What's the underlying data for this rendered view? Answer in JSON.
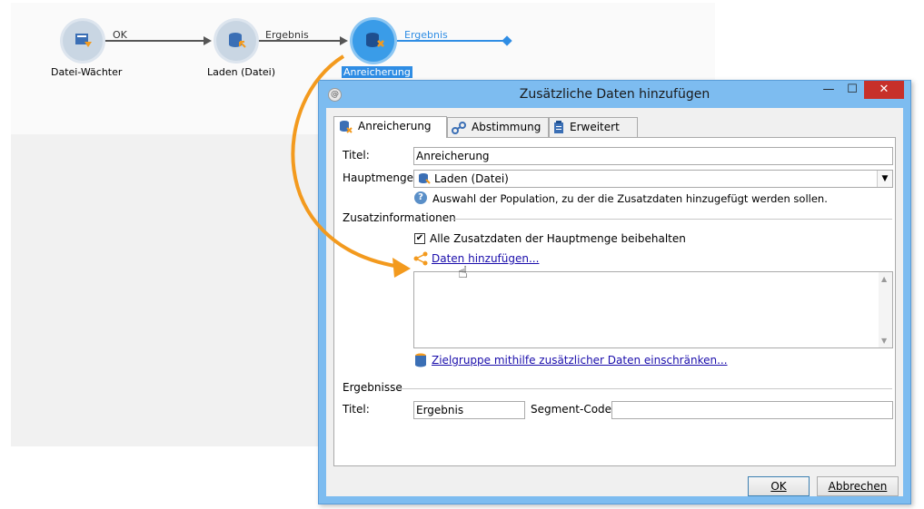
{
  "workflow": {
    "nodes": [
      {
        "label": "Datei-Wächter",
        "icon": "file-watcher-icon"
      },
      {
        "label": "Laden (Datei)",
        "icon": "load-file-icon"
      },
      {
        "label": "Anreicherung",
        "icon": "enrichment-icon"
      }
    ],
    "edges": [
      {
        "label": "OK"
      },
      {
        "label": "Ergebnis"
      },
      {
        "label": "Ergebnis"
      }
    ]
  },
  "dialog": {
    "title": "Zusätzliche Daten hinzufügen",
    "window_buttons": {
      "minimize": "—",
      "maximize": "☐",
      "close": "✕"
    },
    "tabs": [
      {
        "label": "Anreicherung",
        "icon": "enrichment-icon",
        "active": true
      },
      {
        "label": "Abstimmung",
        "icon": "link-icon",
        "active": false
      },
      {
        "label": "Erweitert",
        "icon": "clipboard-icon",
        "active": false
      }
    ],
    "title_label": "Titel:",
    "title_value": "Anreicherung",
    "main_set_label": "Hauptmenge:",
    "main_set_value": "Laden (Datei)",
    "main_set_help": "Auswahl der Population, zu der die Zusatzdaten hinzugefügt werden sollen.",
    "additional_section": "Zusatzinformationen",
    "keep_all_checkbox": {
      "label": "Alle Zusatzdaten der Hauptmenge beibehalten",
      "checked": true
    },
    "add_data_link": "Daten hinzufügen...",
    "restrict_link": "Zielgruppe mithilfe zusätzlicher Daten einschränken...",
    "results_section": "Ergebnisse",
    "result_title_label": "Titel:",
    "result_title_value": "Ergebnis",
    "segment_code_label": "Segment-Code:",
    "segment_code_value": "",
    "ok_button": "OK",
    "cancel_button": "Abbrechen"
  },
  "colors": {
    "accent": "#2f8de4",
    "arrow": "#f39a1e",
    "titlebar": "#7dbcf0",
    "close": "#c7302a"
  }
}
